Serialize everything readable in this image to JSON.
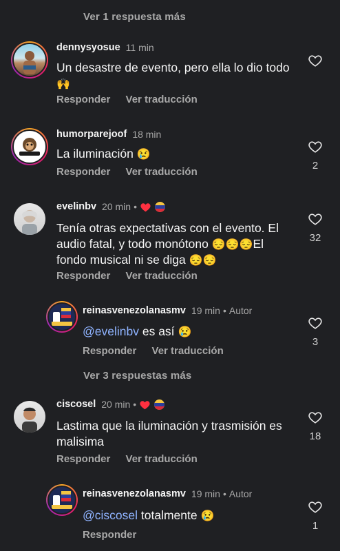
{
  "top_more": "Ver 1 respuesta más",
  "comments": [
    {
      "user": "dennysyosue",
      "time": "11 min",
      "text": "Un desastre de evento, pero ella lo dio todo",
      "emoji": "🙌",
      "reply_label": "Responder",
      "translate_label": "Ver traducción",
      "likes": ""
    },
    {
      "user": "humorparejoof",
      "time": "18 min",
      "text": "La iluminación",
      "emoji": "😢",
      "reply_label": "Responder",
      "translate_label": "Ver traducción",
      "likes": "2"
    },
    {
      "user": "evelinbv",
      "time": "20 min",
      "text_line1": "Tenía otras expectativas con el evento. El",
      "text_line2": "audio fatal, y todo monótono",
      "emoji_mid": "😔😔😔",
      "text_line2b": "El",
      "text_line3": "fondo musical ni se diga",
      "emoji_end": "😔😔",
      "reply_label": "Responder",
      "translate_label": "Ver traducción",
      "likes": "32"
    },
    {
      "user": "reinasvenezolanasmv",
      "time": "19 min",
      "author_label": "Autor",
      "mention": "@evelinbv",
      "text": "es así",
      "emoji": "😢",
      "reply_label": "Responder",
      "translate_label": "Ver traducción",
      "likes": "3"
    },
    {
      "more": "Ver 3 respuestas más"
    },
    {
      "user": "ciscosel",
      "time": "20 min",
      "text_line1": "Lastima que la iluminación y trasmisión es",
      "text_line2": "malisima",
      "reply_label": "Responder",
      "translate_label": "Ver traducción",
      "likes": "18"
    },
    {
      "user": "reinasvenezolanasmv",
      "time": "19 min",
      "author_label": "Autor",
      "mention": "@ciscosel",
      "text": "totalmente",
      "emoji": "😢",
      "reply_label": "Responder",
      "likes": "1"
    }
  ],
  "dot": "•"
}
